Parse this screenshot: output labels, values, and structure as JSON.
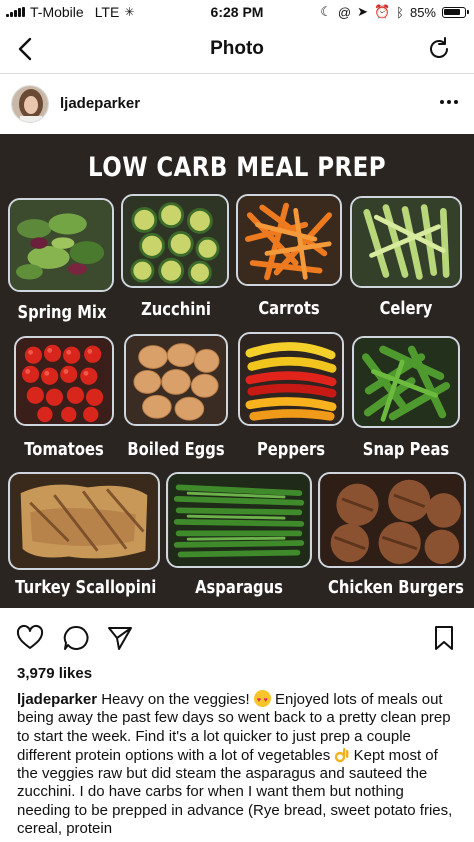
{
  "status_bar": {
    "carrier": "T-Mobile",
    "network": "LTE",
    "time": "6:28 PM",
    "battery": "85%",
    "battery_level": 0.85
  },
  "nav": {
    "title": "Photo",
    "back_icon": "chevron-left-icon",
    "refresh_icon": "refresh-icon"
  },
  "post": {
    "username": "ljadeparker",
    "likes": "3,979 likes"
  },
  "photo": {
    "title": "LOW CARB MEAL PREP",
    "items": [
      {
        "label": "Spring Mix"
      },
      {
        "label": "Zucchini"
      },
      {
        "label": "Carrots"
      },
      {
        "label": "Celery"
      },
      {
        "label": "Tomatoes"
      },
      {
        "label": "Boiled Eggs"
      },
      {
        "label": "Peppers"
      },
      {
        "label": "Snap Peas"
      },
      {
        "label": "Turkey Scallopini"
      },
      {
        "label": "Asparagus"
      },
      {
        "label": "Chicken Burgers"
      }
    ]
  },
  "caption": {
    "username": "ljadeparker",
    "part1": "Heavy on the veggies!",
    "part2": "Enjoyed lots of meals out being away the past few days so went back to a pretty clean prep to start the week. Find it's a lot quicker to just prep a couple different protein options with a lot of vegetables",
    "part3": "Kept most of the veggies raw but did steam the asparagus and sauteed the zucchini. I do have carbs for when I want them but nothing needing to be prepped in advance (Rye bread, sweet potato fries, cereal, protein"
  },
  "colors": {
    "accent": "#111111",
    "photo_background": "#2b2522",
    "divider": "#dbdbdb"
  }
}
